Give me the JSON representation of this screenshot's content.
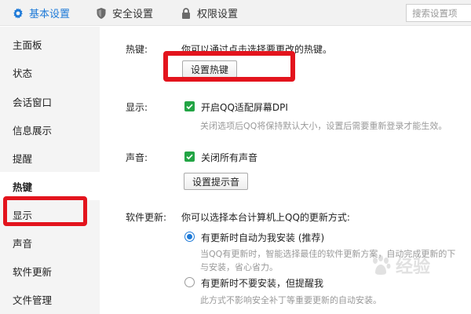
{
  "tabs": [
    {
      "label": "基本设置",
      "icon": "gear-icon",
      "active": true
    },
    {
      "label": "安全设置",
      "icon": "shield-icon",
      "active": false
    },
    {
      "label": "权限设置",
      "icon": "lock-icon",
      "active": false
    }
  ],
  "search": {
    "placeholder": "搜索设置项"
  },
  "sidebar": {
    "items": [
      {
        "label": "主面板"
      },
      {
        "label": "状态"
      },
      {
        "label": "会话窗口"
      },
      {
        "label": "信息展示"
      },
      {
        "label": "提醒"
      },
      {
        "label": "热键",
        "active": true
      },
      {
        "label": "显示"
      },
      {
        "label": "声音"
      },
      {
        "label": "软件更新"
      },
      {
        "label": "文件管理"
      }
    ]
  },
  "main": {
    "hotkey": {
      "label": "热键:",
      "description": "你可以通过点击选择要更改的热键。",
      "button": "设置热键"
    },
    "display": {
      "label": "显示:",
      "checkbox_label": "开启QQ适配屏幕DPI",
      "checked": true,
      "hint": "关闭选项后QQ将保持默认大小，设置后需要重新登录才能生效。"
    },
    "sound": {
      "label": "声音:",
      "checkbox_label": "关闭所有声音",
      "checked": true,
      "button": "设置提示音"
    },
    "update": {
      "label": "软件更新:",
      "description": "你可以选择本台计算机上QQ的更新方式:",
      "options": [
        {
          "label": "有更新时自动为我安装 (推荐)",
          "selected": true,
          "hint": [
            "当QQ有更新时，智能选择最佳的软件更新方案，自动完成更新的下",
            "与安装，省心省力。"
          ]
        },
        {
          "label": "有更新时不要安装，但提醒我",
          "selected": false,
          "hint": [
            "此方式不影响安全补丁等重要更新的自动安装。"
          ]
        }
      ]
    }
  },
  "watermark": {
    "text": "经验",
    "logo": "baidu-paw-logo"
  },
  "colors": {
    "accent": "#1e7ad8",
    "highlight": "#e3141d",
    "check": "#23a545"
  }
}
